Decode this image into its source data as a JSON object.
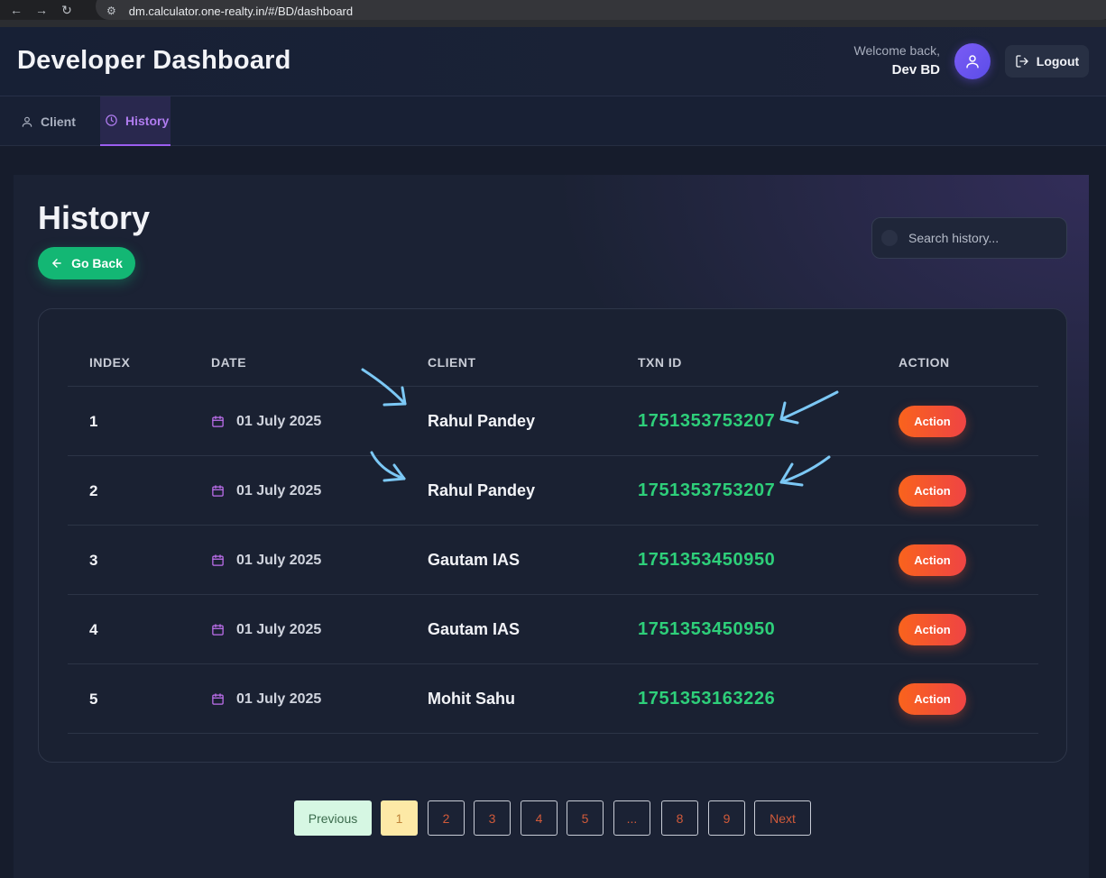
{
  "browser": {
    "url": "dm.calculator.one-realty.in/#/BD/dashboard"
  },
  "header": {
    "title": "Developer Dashboard",
    "welcome_text": "Welcome back,",
    "user_name": "Dev BD",
    "logout_label": "Logout"
  },
  "tabs": [
    {
      "label": "Client",
      "icon": "user-icon",
      "active": false
    },
    {
      "label": "History",
      "icon": "clock-icon",
      "active": true
    }
  ],
  "main": {
    "heading": "History",
    "go_back_label": "Go Back",
    "search_placeholder": "Search history..."
  },
  "table": {
    "columns": [
      "INDEX",
      "DATE",
      "CLIENT",
      "TXN ID",
      "ACTION"
    ],
    "rows": [
      {
        "index": "1",
        "date": "01 July 2025",
        "client": "Rahul Pandey",
        "txn_id": "1751353753207",
        "action": "Action"
      },
      {
        "index": "2",
        "date": "01 July 2025",
        "client": "Rahul Pandey",
        "txn_id": "1751353753207",
        "action": "Action"
      },
      {
        "index": "3",
        "date": "01 July 2025",
        "client": "Gautam IAS",
        "txn_id": "1751353450950",
        "action": "Action"
      },
      {
        "index": "4",
        "date": "01 July 2025",
        "client": "Gautam IAS",
        "txn_id": "1751353450950",
        "action": "Action"
      },
      {
        "index": "5",
        "date": "01 July 2025",
        "client": "Mohit Sahu",
        "txn_id": "1751353163226",
        "action": "Action"
      }
    ]
  },
  "pagination": {
    "previous": "Previous",
    "pages": [
      "1",
      "2",
      "3",
      "4",
      "5",
      "...",
      "8",
      "9"
    ],
    "current": "1",
    "next": "Next"
  },
  "colors": {
    "accent_purple": "#9b5ef0",
    "go_back_green": "#13b774",
    "txn_green": "#2ecf7a",
    "action_orange": "#f9631d",
    "annotation_blue": "#7cc8f5"
  }
}
